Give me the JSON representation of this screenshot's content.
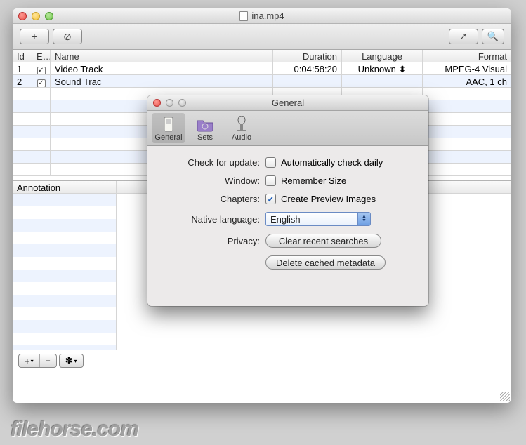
{
  "main": {
    "title": "ina.mp4",
    "toolbar": {
      "add": "+",
      "block": "⊘",
      "share": "↗",
      "search": "🔍"
    },
    "columns": {
      "id": "Id",
      "en": "E...",
      "name": "Name",
      "dur": "Duration",
      "lang": "Language",
      "fmt": "Format"
    },
    "rows": [
      {
        "id": "1",
        "en": true,
        "name": "Video Track",
        "dur": "0:04:58:20",
        "lang": "Unknown",
        "fmt": "MPEG-4 Visual"
      },
      {
        "id": "2",
        "en": true,
        "name": "Sound Trac",
        "dur": "",
        "lang": "",
        "fmt": "AAC, 1 ch"
      }
    ],
    "annotation_header": "Annotation",
    "footer": {
      "add": "+",
      "add_dd": "▾",
      "remove": "−",
      "gear": "✽",
      "gear_dd": "▾"
    }
  },
  "dialog": {
    "title": "General",
    "tabs": [
      {
        "id": "general",
        "label": "General",
        "icon": "switch",
        "selected": true
      },
      {
        "id": "sets",
        "label": "Sets",
        "icon": "folder",
        "selected": false
      },
      {
        "id": "audio",
        "label": "Audio",
        "icon": "mic",
        "selected": false
      }
    ],
    "fields": {
      "update": {
        "lab": "Check for update:",
        "txt": "Automatically check daily",
        "on": false
      },
      "window": {
        "lab": "Window:",
        "txt": "Remember Size",
        "on": false
      },
      "chapters": {
        "lab": "Chapters:",
        "txt": "Create Preview Images",
        "on": true
      },
      "lang": {
        "lab": "Native language:",
        "val": "English"
      },
      "privacy": {
        "lab": "Privacy:",
        "b1": "Clear recent searches",
        "b2": "Delete cached metadata"
      }
    }
  },
  "watermark": "filehorse.com"
}
